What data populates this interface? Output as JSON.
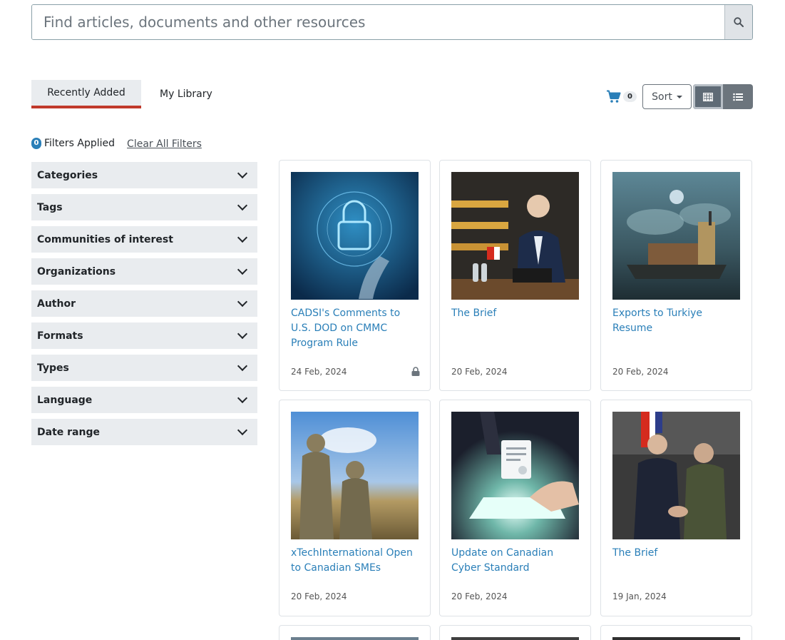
{
  "search": {
    "placeholder": "Find articles, documents and other resources"
  },
  "tabs": [
    {
      "label": "Recently Added",
      "active": true
    },
    {
      "label": "My Library",
      "active": false
    }
  ],
  "toolbar": {
    "cart_count": "0",
    "sort_label": "Sort"
  },
  "filters": {
    "applied_count": "0",
    "applied_label": "Filters Applied",
    "clear_label": "Clear All Filters",
    "items": [
      "Categories",
      "Tags",
      "Communities of interest",
      "Organizations",
      "Author",
      "Formats",
      "Types",
      "Language",
      "Date range"
    ]
  },
  "cards": [
    {
      "title": "CADSI's Comments to U.S. DOD on CMMC Program Rule",
      "date": "24 Feb, 2024",
      "locked": true
    },
    {
      "title": "The Brief",
      "date": "20 Feb, 2024",
      "locked": false
    },
    {
      "title": "Exports to Turkiye Resume",
      "date": "20 Feb, 2024",
      "locked": false
    },
    {
      "title": "xTechInternational Open to Canadian SMEs",
      "date": "20 Feb, 2024",
      "locked": false
    },
    {
      "title": "Update on Canadian Cyber Standard",
      "date": "20 Feb, 2024",
      "locked": false
    },
    {
      "title": "The Brief",
      "date": "19 Jan, 2024",
      "locked": false
    }
  ],
  "colors": {
    "accent": "#2a7fb8",
    "tab_underline": "#c0392b",
    "panel": "#e9ecef"
  }
}
